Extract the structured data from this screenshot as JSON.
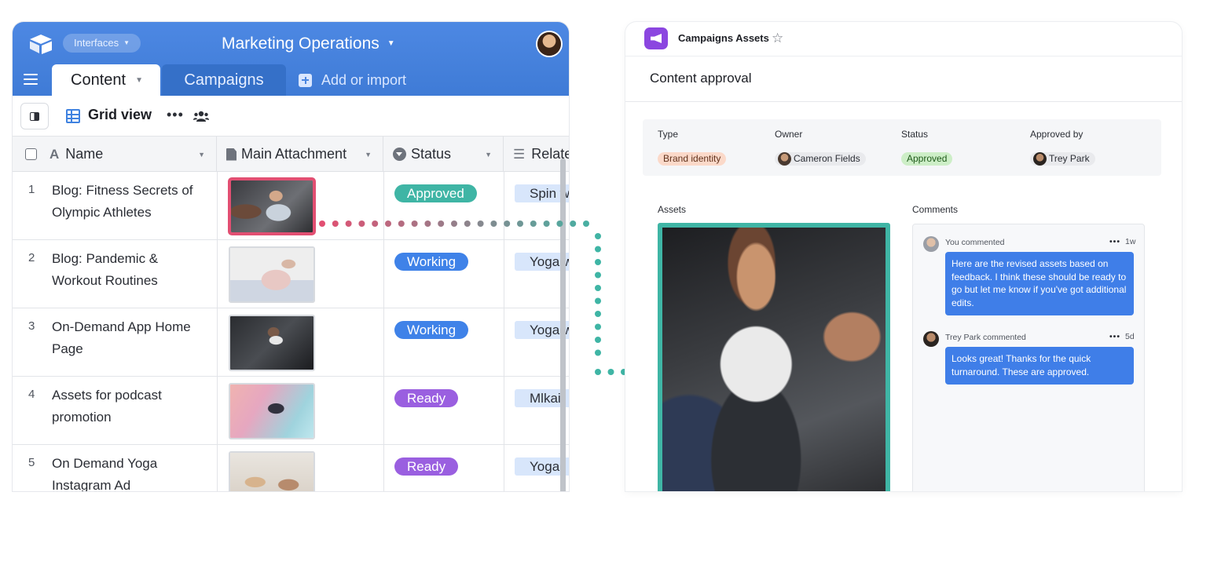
{
  "left": {
    "interfaces_label": "Interfaces",
    "base_title": "Marketing Operations",
    "tabs": [
      {
        "label": "Content"
      },
      {
        "label": "Campaigns"
      }
    ],
    "add_import_label": "Add or import",
    "view": {
      "name": "Grid view"
    },
    "columns": [
      {
        "label": "Name"
      },
      {
        "label": "Main Attachment"
      },
      {
        "label": "Status"
      },
      {
        "label": "Relate"
      }
    ],
    "rows": [
      {
        "num": "1",
        "name": "Blog: Fitness Secrets of Olympic Athletes",
        "status": "Approved",
        "status_color": "#3fb5a5",
        "related": "Spin w"
      },
      {
        "num": "2",
        "name": "Blog: Pandemic & Workout Routines",
        "status": "Working",
        "status_color": "#3f82e8",
        "related": "Yoga w"
      },
      {
        "num": "3",
        "name": "On-Demand App Home Page",
        "status": "Working",
        "status_color": "#3f82e8",
        "related": "Yoga w"
      },
      {
        "num": "4",
        "name": "Assets for podcast promotion",
        "status": "Ready",
        "status_color": "#9a5fe0",
        "related": "Mlkail"
      },
      {
        "num": "5",
        "name": "On Demand Yoga Instagram Ad",
        "status": "Ready",
        "status_color": "#9a5fe0",
        "related": "Yoga"
      }
    ]
  },
  "right": {
    "app_title": "Campaigns Assets",
    "page_title": "Content approval",
    "fields": {
      "type_label": "Type",
      "type_value": "Brand identity",
      "owner_label": "Owner",
      "owner_value": "Cameron Fields",
      "status_label": "Status",
      "status_value": "Approved",
      "approved_by_label": "Approved by",
      "approved_by_value": "Trey Park"
    },
    "assets_label": "Assets",
    "comments_label": "Comments",
    "comments": [
      {
        "author": "You commented",
        "time": "1w",
        "text": "Here are the revised assets based on feedback. I think these should be ready to go but let me know if you've got additional edits."
      },
      {
        "author": "Trey Park commented",
        "time": "5d",
        "text": "Looks great! Thanks for the quick turnaround. These are approved."
      }
    ]
  },
  "colors": {
    "topbar": "#4b86e0",
    "highlight_border": "#e24f72",
    "asset_border": "#3fb5a5",
    "comment_bubble": "#3f7ee8",
    "app_icon": "#8b46e0"
  }
}
